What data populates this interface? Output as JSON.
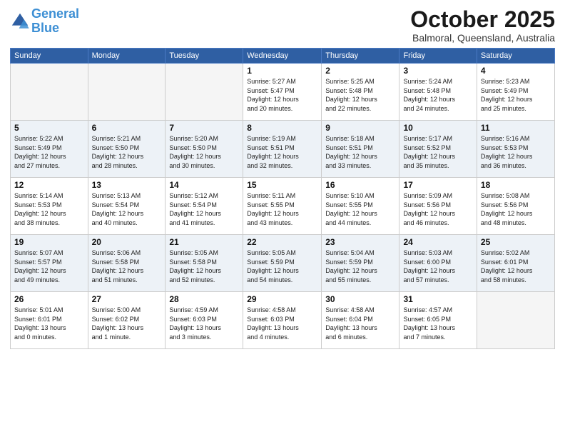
{
  "header": {
    "logo_line1": "General",
    "logo_line2": "Blue",
    "month": "October 2025",
    "location": "Balmoral, Queensland, Australia"
  },
  "weekdays": [
    "Sunday",
    "Monday",
    "Tuesday",
    "Wednesday",
    "Thursday",
    "Friday",
    "Saturday"
  ],
  "weeks": [
    [
      {
        "day": "",
        "info": ""
      },
      {
        "day": "",
        "info": ""
      },
      {
        "day": "",
        "info": ""
      },
      {
        "day": "1",
        "info": "Sunrise: 5:27 AM\nSunset: 5:47 PM\nDaylight: 12 hours\nand 20 minutes."
      },
      {
        "day": "2",
        "info": "Sunrise: 5:25 AM\nSunset: 5:48 PM\nDaylight: 12 hours\nand 22 minutes."
      },
      {
        "day": "3",
        "info": "Sunrise: 5:24 AM\nSunset: 5:48 PM\nDaylight: 12 hours\nand 24 minutes."
      },
      {
        "day": "4",
        "info": "Sunrise: 5:23 AM\nSunset: 5:49 PM\nDaylight: 12 hours\nand 25 minutes."
      }
    ],
    [
      {
        "day": "5",
        "info": "Sunrise: 5:22 AM\nSunset: 5:49 PM\nDaylight: 12 hours\nand 27 minutes."
      },
      {
        "day": "6",
        "info": "Sunrise: 5:21 AM\nSunset: 5:50 PM\nDaylight: 12 hours\nand 28 minutes."
      },
      {
        "day": "7",
        "info": "Sunrise: 5:20 AM\nSunset: 5:50 PM\nDaylight: 12 hours\nand 30 minutes."
      },
      {
        "day": "8",
        "info": "Sunrise: 5:19 AM\nSunset: 5:51 PM\nDaylight: 12 hours\nand 32 minutes."
      },
      {
        "day": "9",
        "info": "Sunrise: 5:18 AM\nSunset: 5:51 PM\nDaylight: 12 hours\nand 33 minutes."
      },
      {
        "day": "10",
        "info": "Sunrise: 5:17 AM\nSunset: 5:52 PM\nDaylight: 12 hours\nand 35 minutes."
      },
      {
        "day": "11",
        "info": "Sunrise: 5:16 AM\nSunset: 5:53 PM\nDaylight: 12 hours\nand 36 minutes."
      }
    ],
    [
      {
        "day": "12",
        "info": "Sunrise: 5:14 AM\nSunset: 5:53 PM\nDaylight: 12 hours\nand 38 minutes."
      },
      {
        "day": "13",
        "info": "Sunrise: 5:13 AM\nSunset: 5:54 PM\nDaylight: 12 hours\nand 40 minutes."
      },
      {
        "day": "14",
        "info": "Sunrise: 5:12 AM\nSunset: 5:54 PM\nDaylight: 12 hours\nand 41 minutes."
      },
      {
        "day": "15",
        "info": "Sunrise: 5:11 AM\nSunset: 5:55 PM\nDaylight: 12 hours\nand 43 minutes."
      },
      {
        "day": "16",
        "info": "Sunrise: 5:10 AM\nSunset: 5:55 PM\nDaylight: 12 hours\nand 44 minutes."
      },
      {
        "day": "17",
        "info": "Sunrise: 5:09 AM\nSunset: 5:56 PM\nDaylight: 12 hours\nand 46 minutes."
      },
      {
        "day": "18",
        "info": "Sunrise: 5:08 AM\nSunset: 5:56 PM\nDaylight: 12 hours\nand 48 minutes."
      }
    ],
    [
      {
        "day": "19",
        "info": "Sunrise: 5:07 AM\nSunset: 5:57 PM\nDaylight: 12 hours\nand 49 minutes."
      },
      {
        "day": "20",
        "info": "Sunrise: 5:06 AM\nSunset: 5:58 PM\nDaylight: 12 hours\nand 51 minutes."
      },
      {
        "day": "21",
        "info": "Sunrise: 5:05 AM\nSunset: 5:58 PM\nDaylight: 12 hours\nand 52 minutes."
      },
      {
        "day": "22",
        "info": "Sunrise: 5:05 AM\nSunset: 5:59 PM\nDaylight: 12 hours\nand 54 minutes."
      },
      {
        "day": "23",
        "info": "Sunrise: 5:04 AM\nSunset: 5:59 PM\nDaylight: 12 hours\nand 55 minutes."
      },
      {
        "day": "24",
        "info": "Sunrise: 5:03 AM\nSunset: 6:00 PM\nDaylight: 12 hours\nand 57 minutes."
      },
      {
        "day": "25",
        "info": "Sunrise: 5:02 AM\nSunset: 6:01 PM\nDaylight: 12 hours\nand 58 minutes."
      }
    ],
    [
      {
        "day": "26",
        "info": "Sunrise: 5:01 AM\nSunset: 6:01 PM\nDaylight: 13 hours\nand 0 minutes."
      },
      {
        "day": "27",
        "info": "Sunrise: 5:00 AM\nSunset: 6:02 PM\nDaylight: 13 hours\nand 1 minute."
      },
      {
        "day": "28",
        "info": "Sunrise: 4:59 AM\nSunset: 6:03 PM\nDaylight: 13 hours\nand 3 minutes."
      },
      {
        "day": "29",
        "info": "Sunrise: 4:58 AM\nSunset: 6:03 PM\nDaylight: 13 hours\nand 4 minutes."
      },
      {
        "day": "30",
        "info": "Sunrise: 4:58 AM\nSunset: 6:04 PM\nDaylight: 13 hours\nand 6 minutes."
      },
      {
        "day": "31",
        "info": "Sunrise: 4:57 AM\nSunset: 6:05 PM\nDaylight: 13 hours\nand 7 minutes."
      },
      {
        "day": "",
        "info": ""
      }
    ]
  ]
}
